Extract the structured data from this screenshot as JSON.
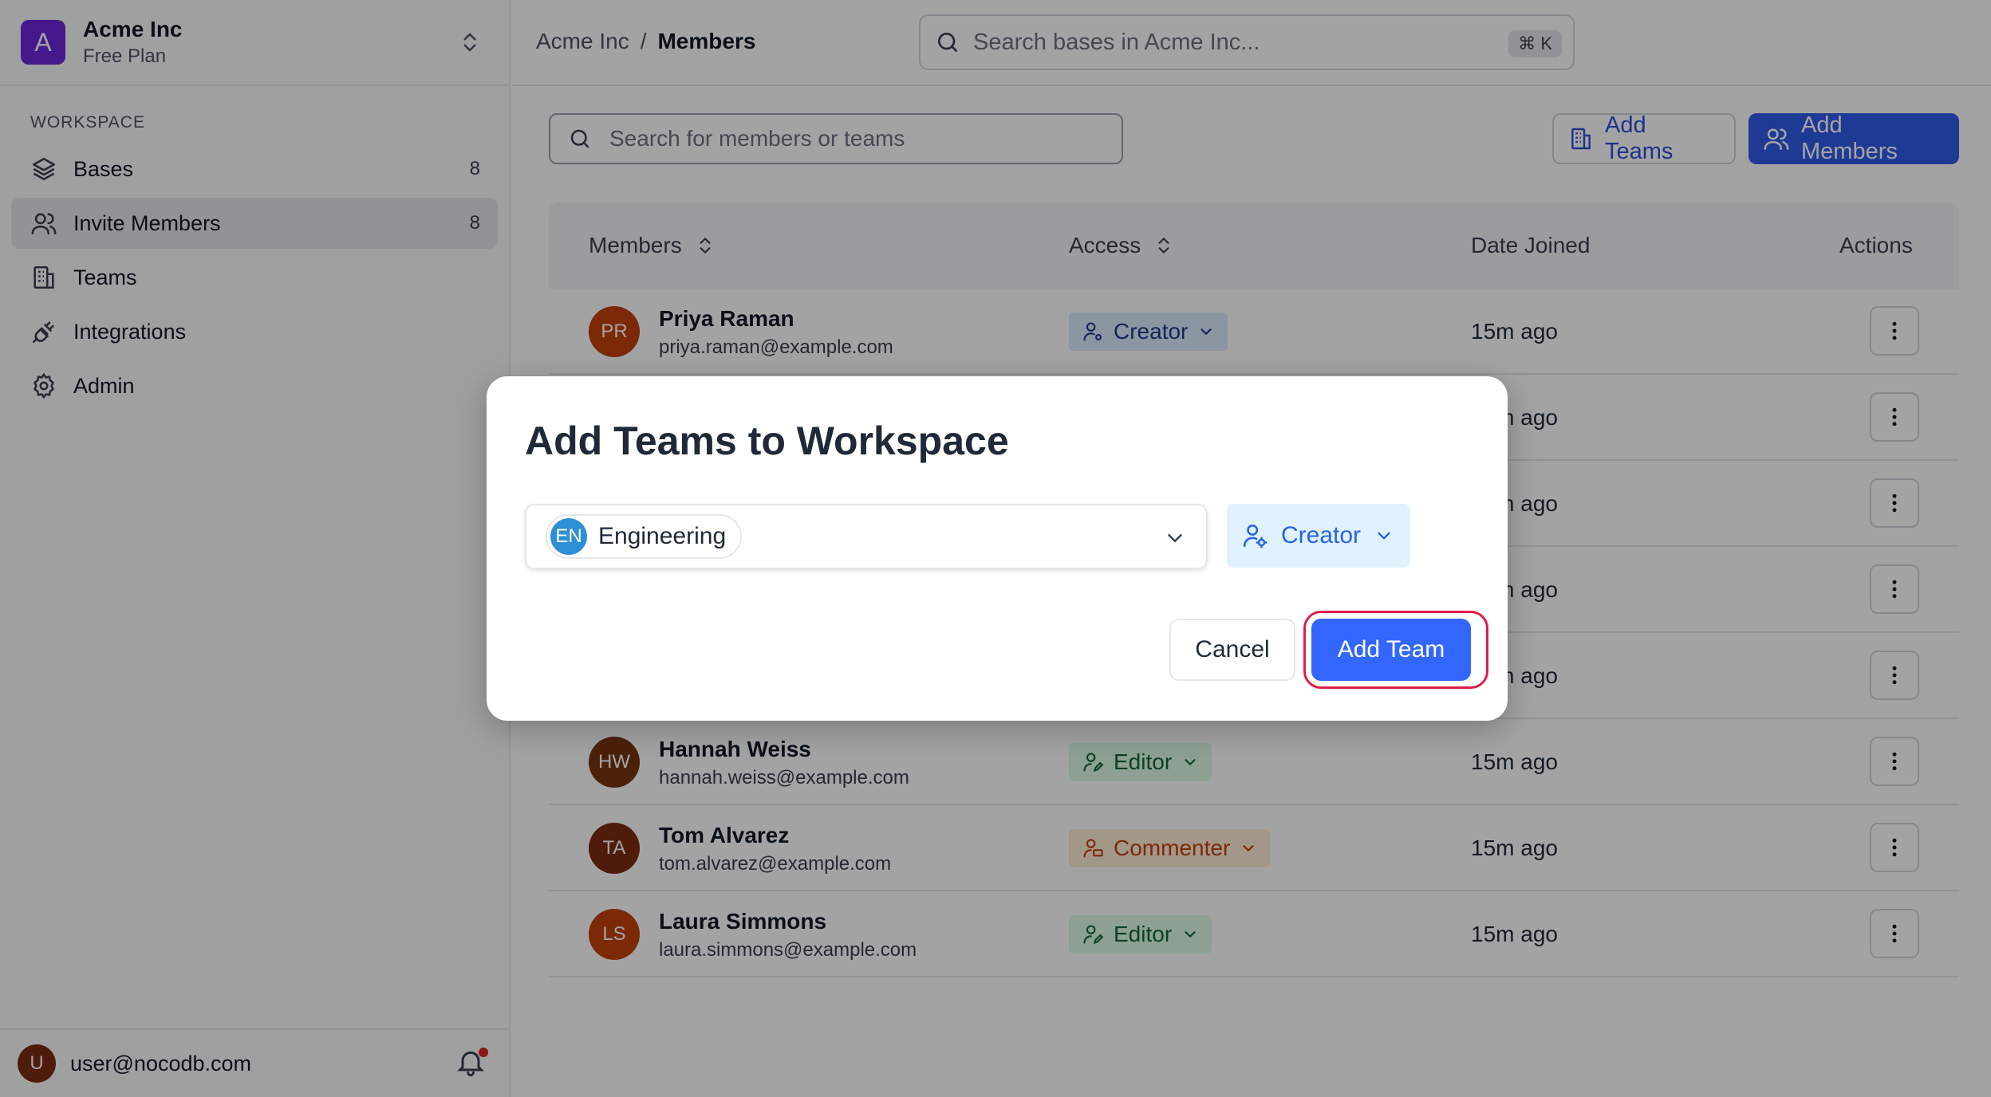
{
  "workspace": {
    "avatar_letter": "A",
    "name": "Acme Inc",
    "plan": "Free Plan",
    "avatar_color": "#6d28d9"
  },
  "sidebar": {
    "section_label": "WORKSPACE",
    "items": [
      {
        "label": "Bases",
        "count": "8",
        "icon": "layers-icon",
        "active": false
      },
      {
        "label": "Invite Members",
        "count": "8",
        "icon": "users-icon",
        "active": true
      },
      {
        "label": "Teams",
        "count": "",
        "icon": "building-icon",
        "active": false
      },
      {
        "label": "Integrations",
        "count": "",
        "icon": "plug-icon",
        "active": false
      },
      {
        "label": "Admin",
        "count": "",
        "icon": "gear-icon",
        "active": false
      }
    ],
    "footer": {
      "avatar_letter": "U",
      "email": "user@nocodb.com"
    }
  },
  "header": {
    "breadcrumb": [
      "Acme Inc",
      "/",
      "Members"
    ],
    "search_placeholder": "Search bases in Acme Inc...",
    "shortcut": "⌘ K"
  },
  "toolbar": {
    "search_placeholder": "Search for members or teams",
    "add_teams_label": "Add Teams",
    "add_members_label": "Add Members"
  },
  "table": {
    "columns": [
      "Members",
      "Access",
      "Date Joined",
      "Actions"
    ],
    "rows": [
      {
        "initials": "PR",
        "color": "#c2410c",
        "name": "Priya Raman",
        "email": "priya.raman@example.com",
        "role": "Creator",
        "role_type": "creator",
        "joined": "15m ago"
      },
      {
        "initials": "",
        "color": "#ffffff",
        "name": "",
        "email": "",
        "role": "",
        "role_type": "",
        "joined": "15m ago"
      },
      {
        "initials": "",
        "color": "#ffffff",
        "name": "",
        "email": "",
        "role": "",
        "role_type": "",
        "joined": "15m ago"
      },
      {
        "initials": "",
        "color": "#ffffff",
        "name": "",
        "email": "",
        "role": "",
        "role_type": "",
        "joined": "15m ago"
      },
      {
        "initials": "",
        "color": "#ffffff",
        "name": "",
        "email": "",
        "role": "",
        "role_type": "",
        "joined": "15m ago"
      },
      {
        "initials": "HW",
        "color": "#78350f",
        "name": "Hannah Weiss",
        "email": "hannah.weiss@example.com",
        "role": "Editor",
        "role_type": "editor",
        "joined": "15m ago"
      },
      {
        "initials": "TA",
        "color": "#7c2d12",
        "name": "Tom Alvarez",
        "email": "tom.alvarez@example.com",
        "role": "Commenter",
        "role_type": "commenter",
        "joined": "15m ago"
      },
      {
        "initials": "LS",
        "color": "#c2410c",
        "name": "Laura Simmons",
        "email": "laura.simmons@example.com",
        "role": "Editor",
        "role_type": "editor",
        "joined": "15m ago"
      }
    ]
  },
  "modal": {
    "title": "Add Teams to Workspace",
    "selected_team": {
      "initials": "EN",
      "label": "Engineering",
      "color": "#2d8fd5"
    },
    "role": "Creator",
    "cancel_label": "Cancel",
    "confirm_label": "Add Team"
  }
}
